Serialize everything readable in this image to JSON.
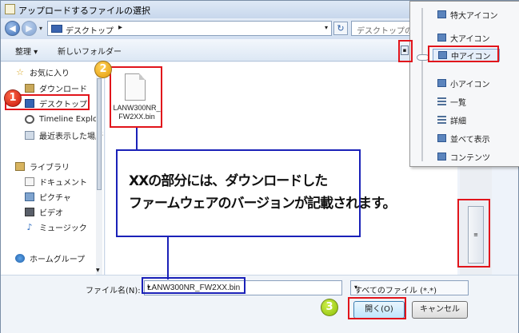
{
  "window": {
    "title": "アップロードするファイルの選択"
  },
  "address_bar": {
    "back_glyph": "◀",
    "forward_glyph": "▶",
    "path": "デスクトップ",
    "path_chevron": "▸",
    "dropdown_glyph": "▾",
    "refresh_glyph": "↻",
    "search_placeholder": "デスクトップの"
  },
  "toolbar": {
    "organize_label": "整理 ▾",
    "new_folder_label": "新しいフォルダー",
    "view_button_glyph": "▪"
  },
  "sidebar": {
    "favorites_label": "お気に入り",
    "items": [
      {
        "label": "ダウンロード",
        "icon": "download-icon"
      },
      {
        "label": "デスクトップ",
        "icon": "desktop-icon"
      },
      {
        "label": "Timeline Explor",
        "icon": "timeline-icon"
      },
      {
        "label": "最近表示した場所",
        "icon": "recent-places-icon"
      }
    ],
    "libraries_label": "ライブラリ",
    "library_items": [
      {
        "label": "ドキュメント",
        "icon": "documents-icon"
      },
      {
        "label": "ピクチャ",
        "icon": "pictures-icon"
      },
      {
        "label": "ビデオ",
        "icon": "videos-icon"
      },
      {
        "label": "ミュージック",
        "icon": "music-icon"
      }
    ],
    "homegroup_label": "ホームグループ",
    "star_glyph": "☆",
    "music_glyph": "♪",
    "scroll_down_glyph": "▼"
  },
  "files": [
    {
      "name": "LANW300NR_FW2XX.bin"
    }
  ],
  "view_menu": {
    "items": [
      {
        "label": "特大アイコン",
        "selected": false
      },
      {
        "label": "大アイコン",
        "selected": false
      },
      {
        "label": "中アイコン",
        "selected": true
      },
      {
        "label": "小アイコン",
        "selected": false
      },
      {
        "label": "一覧",
        "selected": false
      },
      {
        "label": "詳細",
        "selected": false
      },
      {
        "label": "並べて表示",
        "selected": false
      },
      {
        "label": "コンテンツ",
        "selected": false
      }
    ]
  },
  "bottom_bar": {
    "filename_label": "ファイル名(N):",
    "filename_value": "LANW300NR_FW2XX.bin",
    "filetype_value": "すべてのファイル (*.*)",
    "dropdown_glyph": "▾",
    "open_button": "開く(O)",
    "cancel_button": "キャンセル"
  },
  "scrollbar_grip": "≡",
  "annotations": {
    "badges": [
      "1",
      "2",
      "3"
    ],
    "callout_line1": "XXの部分には、ダウンロードした",
    "callout_line2": "ファームウェアのバージョンが記載されます。",
    "highlight_color": "#e1141b",
    "callout_color": "#1a21b8"
  }
}
